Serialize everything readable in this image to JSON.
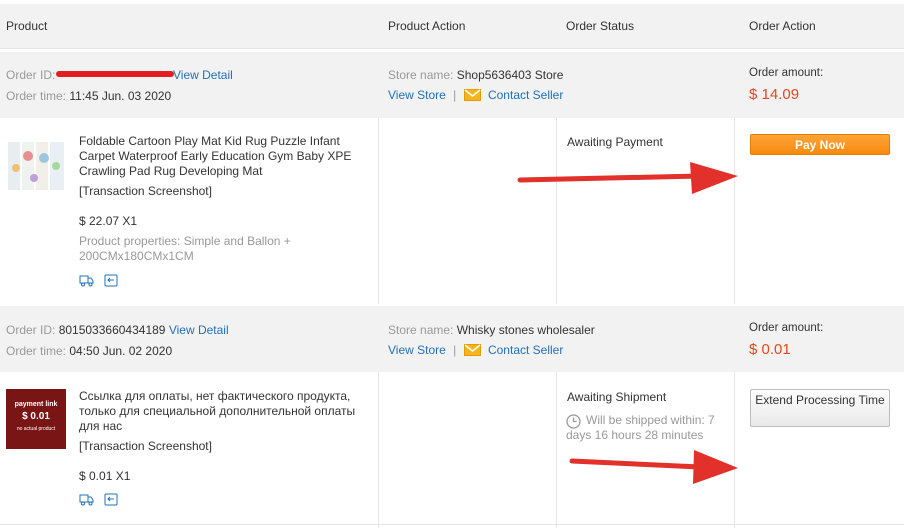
{
  "header": {
    "product": "Product",
    "product_action": "Product Action",
    "order_status": "Order Status",
    "order_action": "Order Action"
  },
  "orders": [
    {
      "order_id_label": "Order ID:",
      "order_id_value": "",
      "view_detail": "View Detail",
      "order_time_label": "Order time:",
      "order_time_value": "11:45 Jun. 03 2020",
      "store_label": "Store name:",
      "store_value": "Shop5636403 Store",
      "view_store": "View Store",
      "separator": "|",
      "contact_seller": "Contact Seller",
      "amount_label": "Order amount:",
      "amount_value": "$ 14.09",
      "product_title": "Foldable Cartoon Play Mat Kid Rug Puzzle Infant Carpet Waterproof Early Education Gym Baby XPE Crawling Pad Rug Developing Mat",
      "screenshot_link": "[Transaction Screenshot]",
      "price_qty": "$ 22.07 X1",
      "properties": "Product properties: Simple and Ballon + 200CMx180CMx1CM",
      "status": "Awaiting Payment",
      "action_button": "Pay Now"
    },
    {
      "order_id_label": "Order ID:",
      "order_id_value": "8015033660434189",
      "view_detail": "View Detail",
      "order_time_label": "Order time:",
      "order_time_value": "04:50 Jun. 02 2020",
      "store_label": "Store name:",
      "store_value": "Whisky stones wholesaler",
      "view_store": "View Store",
      "separator": "|",
      "contact_seller": "Contact Seller",
      "amount_label": "Order amount:",
      "amount_value": "$ 0.01",
      "thumb_line1": "payment link",
      "thumb_line2": "$ 0.01",
      "thumb_line3": "no actual product",
      "product_title": "Ссылка для оплаты, нет фактического продукта, только для специальной дополнительной оплаты для нас",
      "screenshot_link": "[Transaction Screenshot]",
      "price_qty": "$ 0.01 X1",
      "status": "Awaiting Shipment",
      "shipping_note": "Will be shipped within: 7 days 16 hours 28 minutes",
      "action_button": "Extend Processing Time"
    }
  ],
  "colors": {
    "link": "#2270b9",
    "amount": "#e2481d",
    "pay_button": "#f78a0d",
    "arrow": "#e2302a",
    "header_bg": "#f2f2f2"
  },
  "icons": [
    "mail-icon",
    "truck-icon",
    "return-icon",
    "clock-icon",
    "arrow-annotation"
  ]
}
